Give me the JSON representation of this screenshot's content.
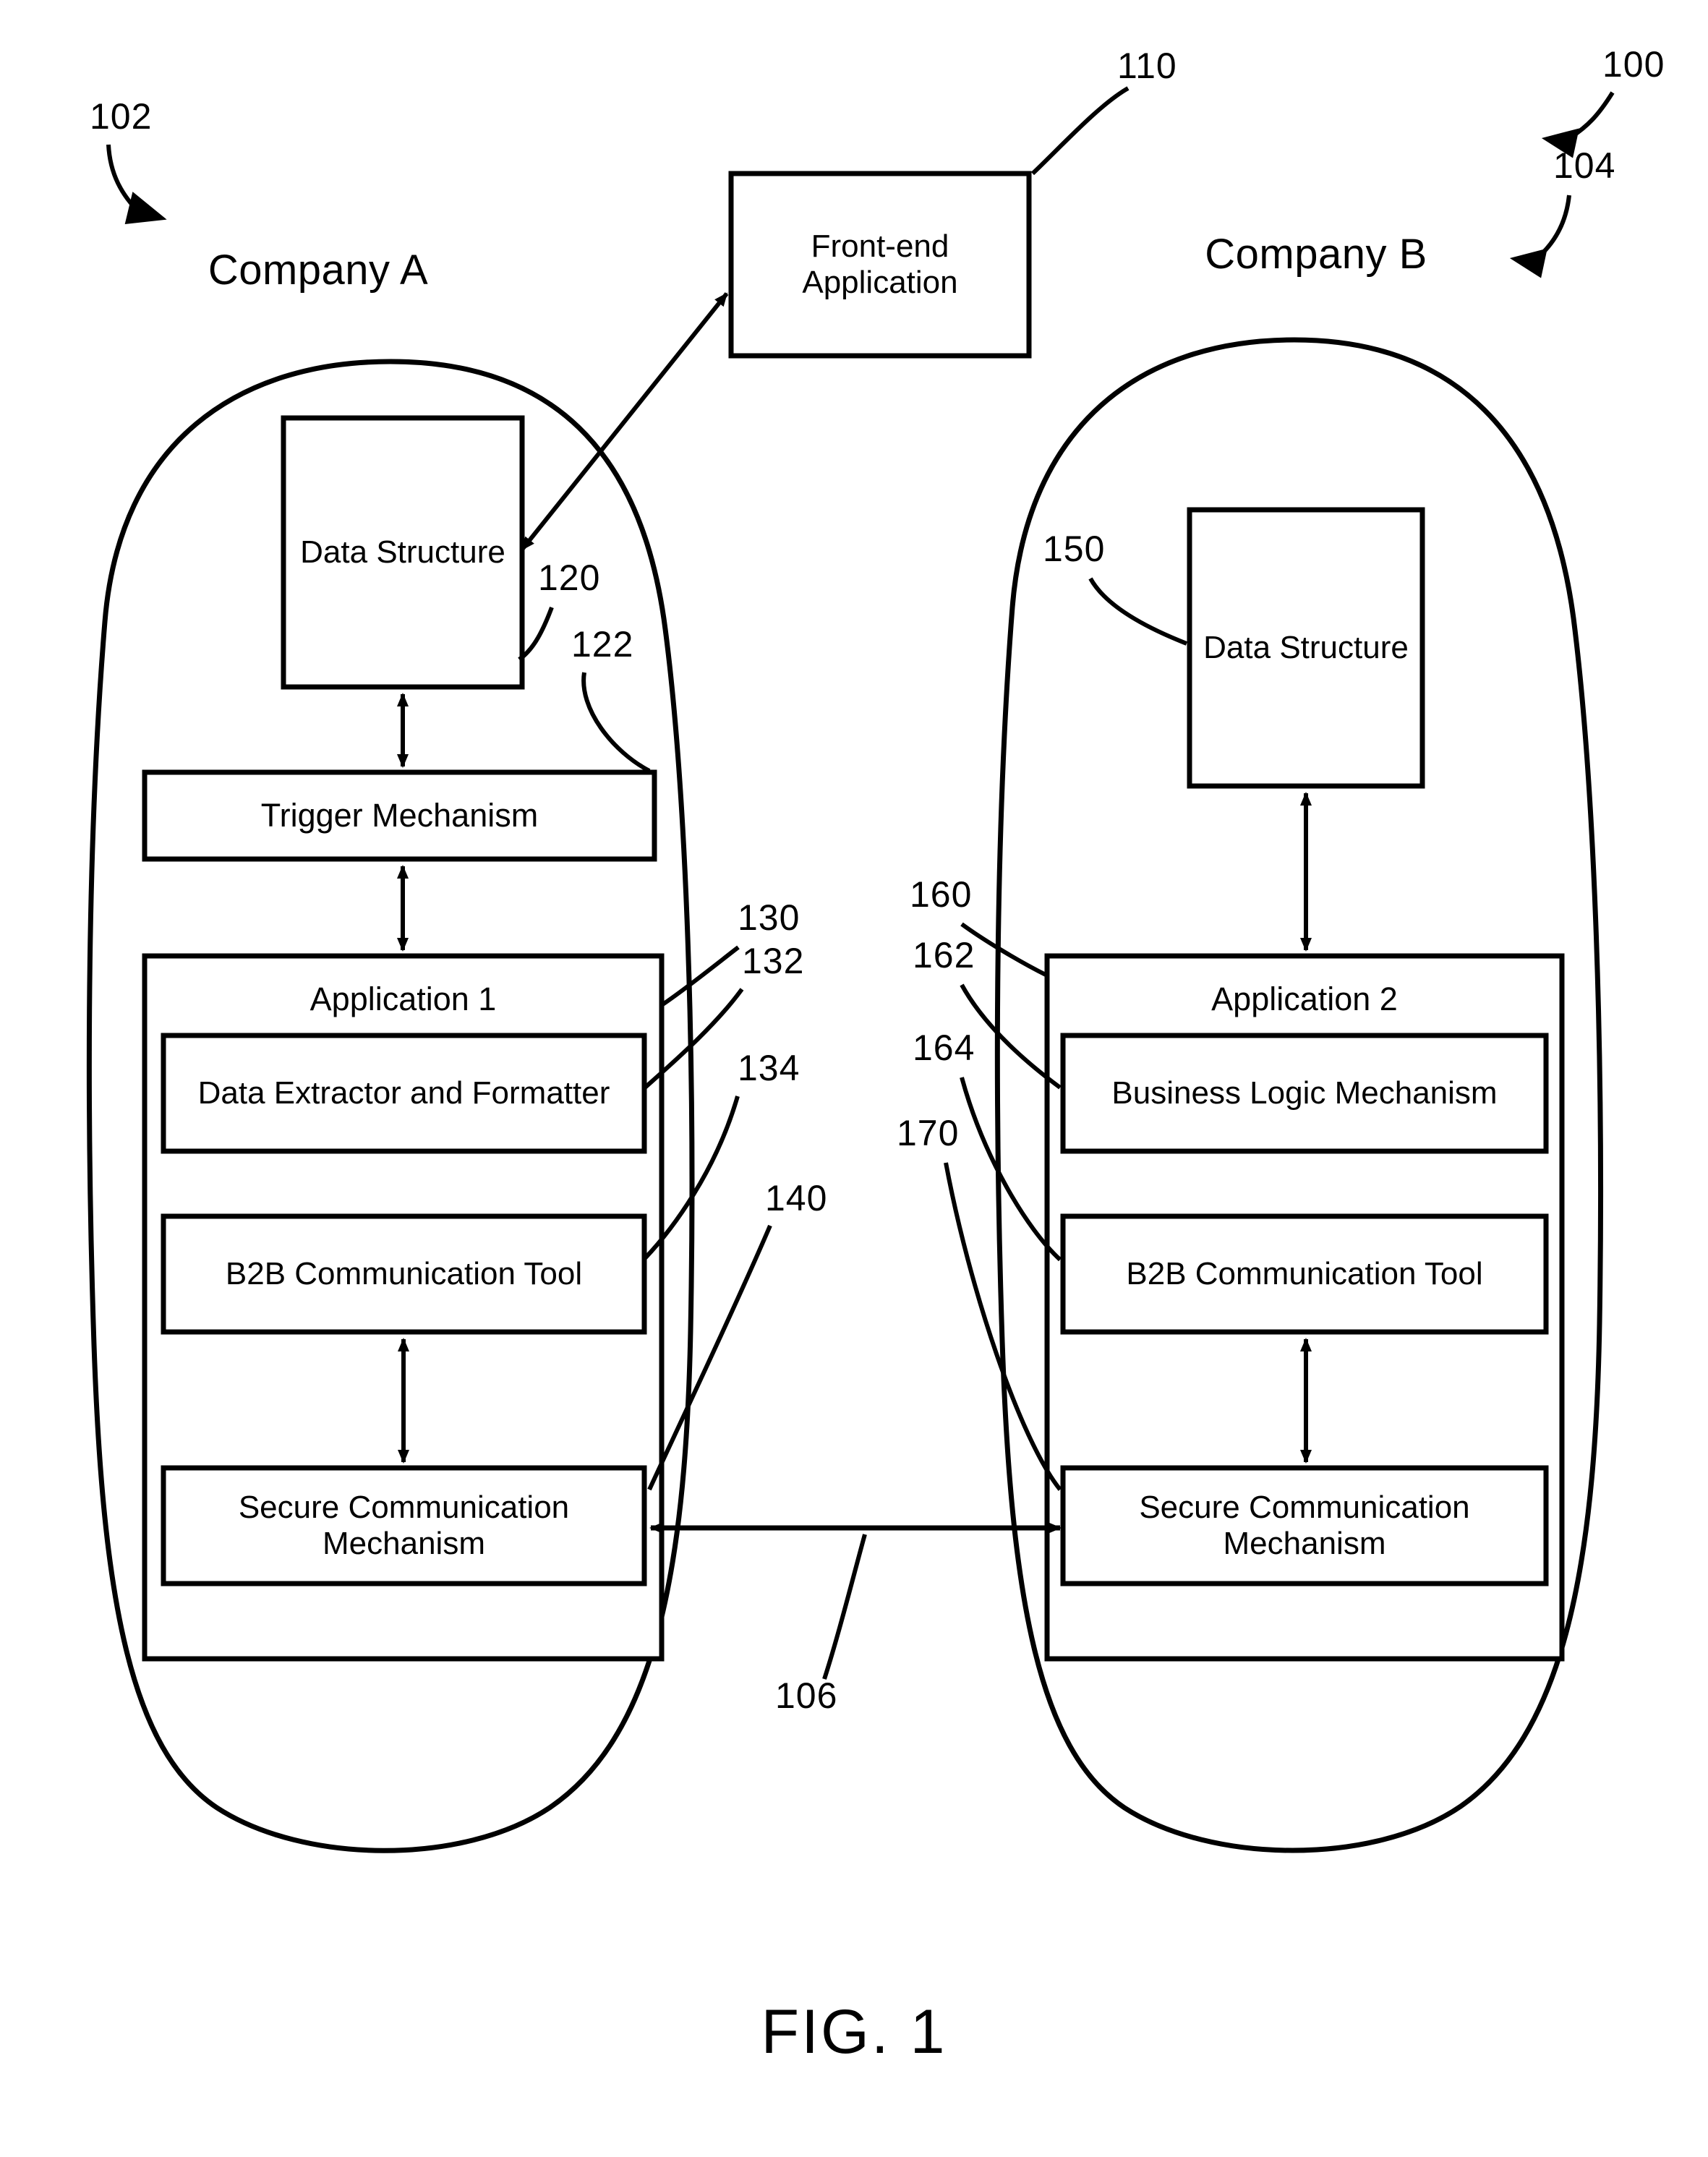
{
  "figure": {
    "caption": "FIG. 1",
    "title_company_a": "Company A",
    "title_company_b": "Company B"
  },
  "reference_numerals": {
    "system": "100",
    "company_a_boundary": "102",
    "company_b_boundary": "104",
    "network_link": "106",
    "front_end_application": "110",
    "data_structure_a": "120",
    "trigger_mechanism": "122",
    "application_1": "130",
    "data_extractor_and_formatter": "132",
    "b2b_communication_tool_a": "134",
    "secure_communication_mechanism_a": "140",
    "data_structure_b": "150",
    "application_2": "160",
    "business_logic_mechanism": "162",
    "b2b_communication_tool_b": "164",
    "secure_communication_mechanism_b": "170"
  },
  "boxes": {
    "front_end_application": "Front-end\nApplication",
    "data_structure_a": "Data\nStructure",
    "trigger_mechanism": "Trigger Mechanism",
    "application_1": "Application 1",
    "data_extractor_and_formatter": "Data Extractor and\nFormatter",
    "b2b_communication_tool_a": "B2B Communication\nTool",
    "secure_communication_mechanism_a": "Secure Communication\nMechanism",
    "data_structure_b": "Data\nStructure",
    "application_2": "Application 2",
    "business_logic_mechanism": "Business Logic\nMechanism",
    "b2b_communication_tool_b": "B2B Communication\nTool",
    "secure_communication_mechanism_b": "Secure Communication\nMechanism"
  },
  "colors": {
    "ink": "#000000",
    "paper": "#ffffff"
  }
}
